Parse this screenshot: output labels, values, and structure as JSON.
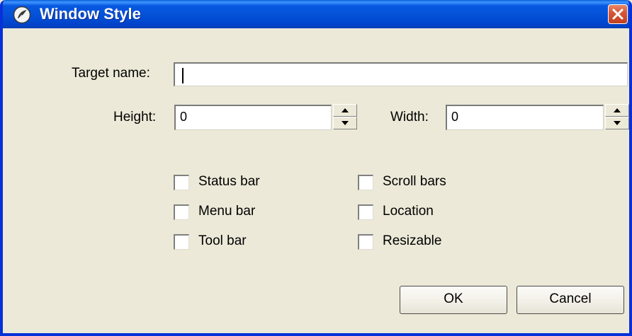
{
  "window": {
    "title": "Window Style",
    "title_icon": "app-leaf-icon",
    "close_icon": "close-icon"
  },
  "form": {
    "target_name_label": "Target name:",
    "target_name_value": "",
    "height_label": "Height:",
    "height_value": "0",
    "width_label": "Width:",
    "width_value": "0"
  },
  "checkboxes": {
    "status_bar": {
      "label": "Status bar",
      "checked": false
    },
    "menu_bar": {
      "label": "Menu bar",
      "checked": false
    },
    "tool_bar": {
      "label": "Tool bar",
      "checked": false
    },
    "scroll_bars": {
      "label": "Scroll bars",
      "checked": false
    },
    "location": {
      "label": "Location",
      "checked": false
    },
    "resizable": {
      "label": "Resizable",
      "checked": false
    }
  },
  "buttons": {
    "ok": "OK",
    "cancel": "Cancel"
  },
  "colors": {
    "title_bar": "#0453d9",
    "dialog_bg": "#ece9d8",
    "close_button": "#d8573a"
  }
}
